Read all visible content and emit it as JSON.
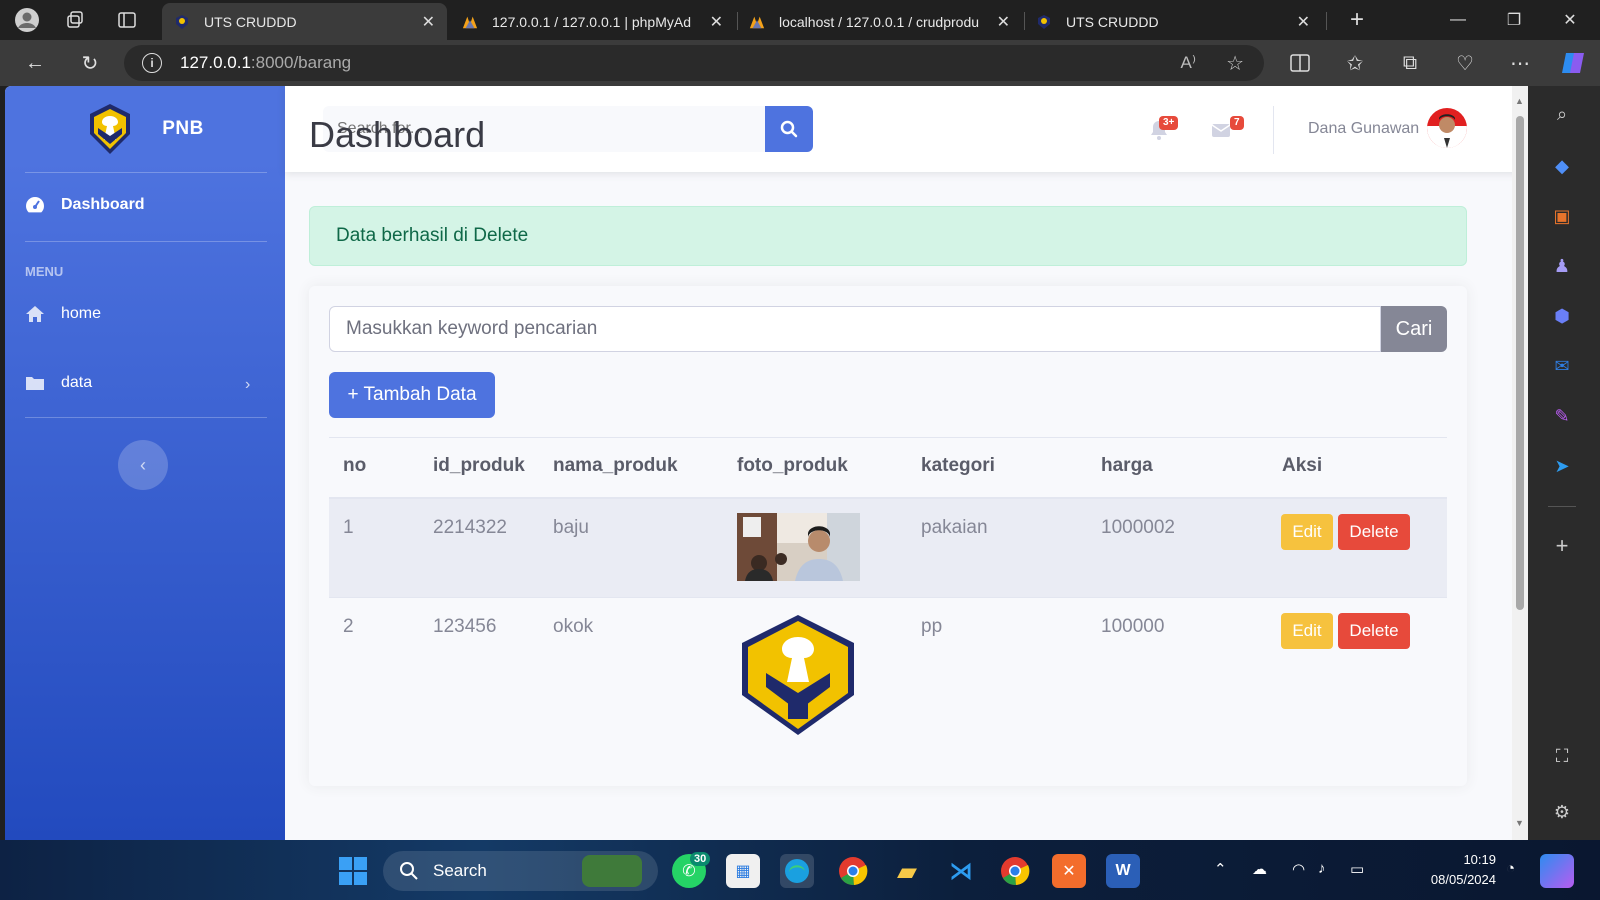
{
  "browser": {
    "tabs": [
      {
        "title": "UTS CRUDDD",
        "active": true
      },
      {
        "title": "127.0.0.1 / 127.0.0.1 | phpMyAd",
        "active": false
      },
      {
        "title": "localhost / 127.0.0.1 / crudprodu",
        "active": false
      },
      {
        "title": "UTS CRUDDD",
        "active": false
      }
    ],
    "url_host": "127.0.0.1",
    "url_rest": ":8000/barang",
    "read_aloud": "A"
  },
  "sidebar": {
    "brand": "PNB",
    "dashboard": "Dashboard",
    "heading": "MENU",
    "items": [
      {
        "label": "home"
      },
      {
        "label": "data"
      }
    ]
  },
  "topbar": {
    "search_placeholder": "Search for...",
    "alerts_badge": "3+",
    "messages_badge": "7",
    "user_name": "Dana Gunawan"
  },
  "main": {
    "title": "Dashboard",
    "alert": "Data berhasil di Delete",
    "keyword_placeholder": "Masukkan keyword pencarian",
    "search_button": "Cari",
    "add_button": "+ Tambah Data",
    "columns": [
      "no",
      "id_produk",
      "nama_produk",
      "foto_produk",
      "kategori",
      "harga",
      "Aksi"
    ],
    "rows": [
      {
        "no": "1",
        "id_produk": "2214322",
        "nama_produk": "baju",
        "kategori": "pakaian",
        "harga": "1000002",
        "edit": "Edit",
        "delete": "Delete"
      },
      {
        "no": "2",
        "id_produk": "123456",
        "nama_produk": "okok",
        "kategori": "pp",
        "harga": "100000",
        "edit": "Edit",
        "delete": "Delete"
      }
    ]
  },
  "taskbar": {
    "search": "Search",
    "whatsapp_badge": "30",
    "time": "10:19",
    "date": "08/05/2024"
  },
  "colors": {
    "primary": "#4e73df",
    "success_bg": "#d4f4e6",
    "warning": "#f6c23e",
    "danger": "#e74a3b",
    "secondary": "#858796"
  }
}
